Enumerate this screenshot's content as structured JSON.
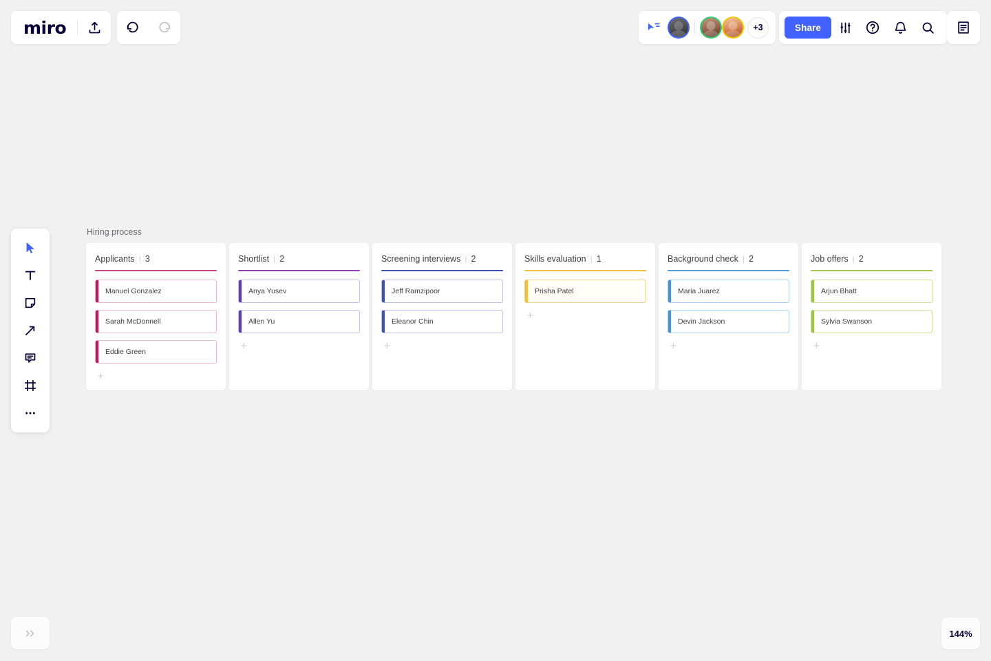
{
  "app": {
    "name": "miro",
    "canvas_bg": "#f1f1f1"
  },
  "toolbar_top_left": {
    "logo_text": "miro",
    "upload_label": "Upload",
    "undo_label": "Undo",
    "redo_label": "Redo"
  },
  "collaborators": {
    "cursor_share_label": "Cursor sharing",
    "avatars": [
      {
        "name": "Collaborator 1",
        "ring_color": "#4262ff"
      },
      {
        "name": "Collaborator 2",
        "ring_color": "#2ecc71"
      },
      {
        "name": "Collaborator 3",
        "ring_color": "#f5c400"
      }
    ],
    "overflow_label": "+3"
  },
  "actions": {
    "share_label": "Share",
    "share_color": "#4262ff",
    "settings_label": "Board settings",
    "help_label": "Help",
    "notifications_label": "Notifications",
    "search_label": "Search",
    "panel_label": "Notes panel"
  },
  "left_toolbar": {
    "items": [
      {
        "icon": "cursor-icon",
        "label": "Select",
        "active": true
      },
      {
        "icon": "text-icon",
        "label": "Text",
        "active": false
      },
      {
        "icon": "sticky-note-icon",
        "label": "Sticky note",
        "active": false
      },
      {
        "icon": "arrow-icon",
        "label": "Connection line",
        "active": false
      },
      {
        "icon": "comment-icon",
        "label": "Comment",
        "active": false
      },
      {
        "icon": "frame-icon",
        "label": "Frame",
        "active": false
      },
      {
        "icon": "more-icon",
        "label": "More tools",
        "active": false
      }
    ]
  },
  "bottom_bar": {
    "expand_label": "»",
    "zoom_level": "144%"
  },
  "frame": {
    "title": "Hiring process"
  },
  "board": {
    "columns": [
      {
        "title": "Applicants",
        "separator": "|",
        "count": "3",
        "rule_color": "#c4487c",
        "card_bar_color": "#c2185b",
        "card_border_color": "#eab9cd",
        "card_bg": "#ffffff",
        "add_label": "+",
        "cards": [
          {
            "name": "Manuel Gonzalez"
          },
          {
            "name": "Sarah McDonnell"
          },
          {
            "name": "Eddie Green"
          }
        ]
      },
      {
        "title": "Shortlist",
        "separator": "|",
        "count": "2",
        "rule_color": "#8e44ad",
        "card_bar_color": "#5b3cc4",
        "card_border_color": "#c5bfe8",
        "card_bg": "#ffffff",
        "add_label": "+",
        "cards": [
          {
            "name": "Anya Yusev"
          },
          {
            "name": "Allen Yu"
          }
        ]
      },
      {
        "title": "Screening interviews",
        "separator": "|",
        "count": "2",
        "rule_color": "#3f51b5",
        "card_bar_color": "#3f51b5",
        "card_border_color": "#bfc4e8",
        "card_bg": "#ffffff",
        "add_label": "+",
        "cards": [
          {
            "name": "Jeff Ramzipoor"
          },
          {
            "name": "Eleanor Chin"
          }
        ]
      },
      {
        "title": "Skills evaluation",
        "separator": "|",
        "count": "1",
        "rule_color": "#edc13c",
        "card_bar_color": "#f0c23a",
        "card_border_color": "#edd48a",
        "card_bg": "#fffdf6",
        "add_label": "+",
        "cards": [
          {
            "name": "Prisha Patel"
          }
        ]
      },
      {
        "title": "Background check",
        "separator": "|",
        "count": "2",
        "rule_color": "#5b9bd5",
        "card_bar_color": "#4a90d9",
        "card_border_color": "#aecfee",
        "card_bg": "#ffffff",
        "add_label": "+",
        "cards": [
          {
            "name": "Maria Juarez"
          },
          {
            "name": "Devin Jackson"
          }
        ]
      },
      {
        "title": "Job offers",
        "separator": "|",
        "count": "2",
        "rule_color": "#a5c64c",
        "card_bar_color": "#9ec44a",
        "card_border_color": "#cfe09a",
        "card_bg": "#ffffff",
        "add_label": "+",
        "cards": [
          {
            "name": "Arjun Bhatt"
          },
          {
            "name": "Sylvia Swanson"
          }
        ]
      }
    ]
  }
}
